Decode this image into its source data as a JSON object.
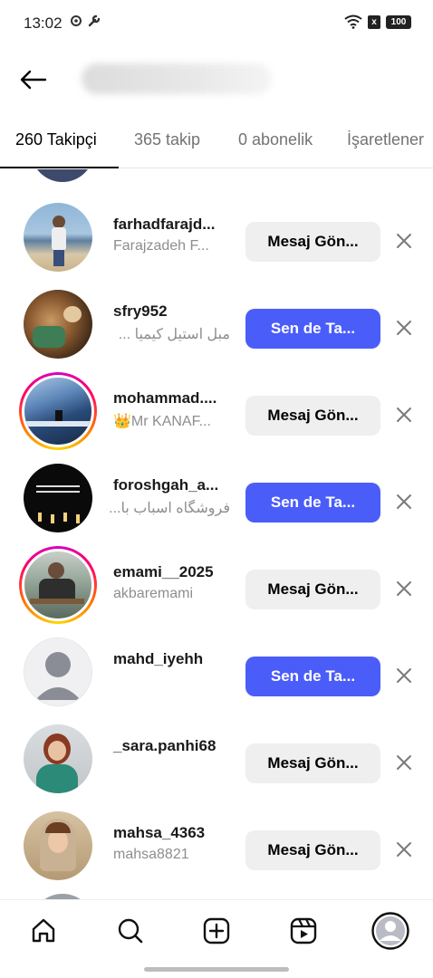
{
  "status": {
    "time": "13:02",
    "battery": "100",
    "sim": "x"
  },
  "header": {
    "back_icon": "arrow-left-icon"
  },
  "tabs": [
    {
      "label": "260 Takipçi",
      "active": true
    },
    {
      "label": "365 takip",
      "active": false
    },
    {
      "label": "0 abonelik",
      "active": false
    },
    {
      "label": "İşaretlener",
      "active": false
    }
  ],
  "rows": [
    {
      "username": "farhadfarajd...",
      "fullname": "Farajzadeh F...",
      "button": "Mesaj Gön...",
      "button_type": "message"
    },
    {
      "username": "sfry952",
      "fullname": "مبل استیل کیمیا ...",
      "button": "Sen de Ta...",
      "button_type": "follow"
    },
    {
      "username": "mohammad....",
      "fullname": "👑Mr KANAF...",
      "button": "Mesaj Gön...",
      "button_type": "message"
    },
    {
      "username": "foroshgah_a...",
      "fullname": "فروشگاه اسباب با...",
      "button": "Sen de Ta...",
      "button_type": "follow"
    },
    {
      "username": "emami__2025",
      "fullname": "akbaremami",
      "button": "Mesaj Gön...",
      "button_type": "message"
    },
    {
      "username": "mahd_iyehh",
      "fullname": "",
      "button": "Sen de Ta...",
      "button_type": "follow"
    },
    {
      "username": "_sara.panhi68",
      "fullname": "",
      "button": "Mesaj Gön...",
      "button_type": "message"
    },
    {
      "username": "mahsa_4363",
      "fullname": "mahsa8821",
      "button": "Mesaj Gön...",
      "button_type": "message"
    }
  ],
  "nav": [
    {
      "icon": "home-icon"
    },
    {
      "icon": "search-icon"
    },
    {
      "icon": "create-icon"
    },
    {
      "icon": "reels-icon"
    },
    {
      "icon": "profile-icon"
    }
  ],
  "colors": {
    "follow_button": "#4a5df9",
    "message_button": "#efefef",
    "muted_text": "#8e8e8e"
  }
}
